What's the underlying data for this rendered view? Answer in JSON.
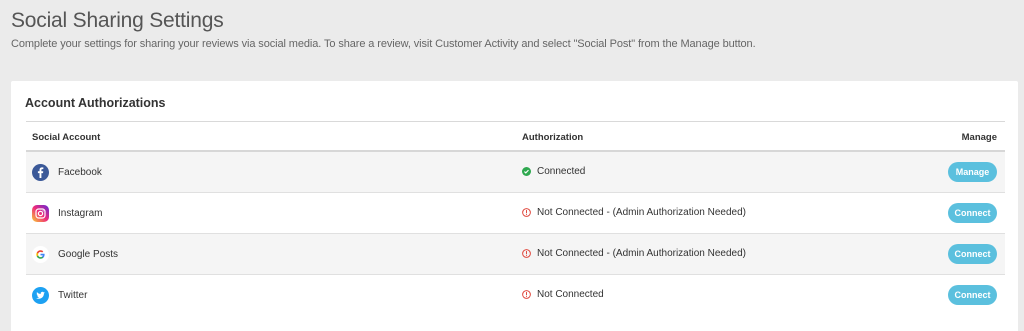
{
  "header": {
    "title": "Social Sharing Settings",
    "subtitle": "Complete your settings for sharing your reviews via social media. To share a review, visit Customer Activity and select \"Social Post\" from the Manage button."
  },
  "card": {
    "title": "Account Authorizations",
    "columns": {
      "account": "Social Account",
      "authorization": "Authorization",
      "manage": "Manage"
    },
    "rows": [
      {
        "account": "Facebook",
        "icon": "facebook-icon",
        "status": "Connected",
        "status_type": "ok",
        "action": "Manage"
      },
      {
        "account": "Instagram",
        "icon": "instagram-icon",
        "status": "Not Connected - (Admin Authorization Needed)",
        "status_type": "error",
        "action": "Connect"
      },
      {
        "account": "Google Posts",
        "icon": "google-icon",
        "status": "Not Connected - (Admin Authorization Needed)",
        "status_type": "error",
        "action": "Connect"
      },
      {
        "account": "Twitter",
        "icon": "twitter-icon",
        "status": "Not Connected",
        "status_type": "error",
        "action": "Connect"
      }
    ]
  },
  "colors": {
    "button": "#5bc0de",
    "ok": "#2ea84f",
    "error": "#e0483e",
    "facebook": "#3b5998",
    "twitter": "#1da1f2"
  }
}
